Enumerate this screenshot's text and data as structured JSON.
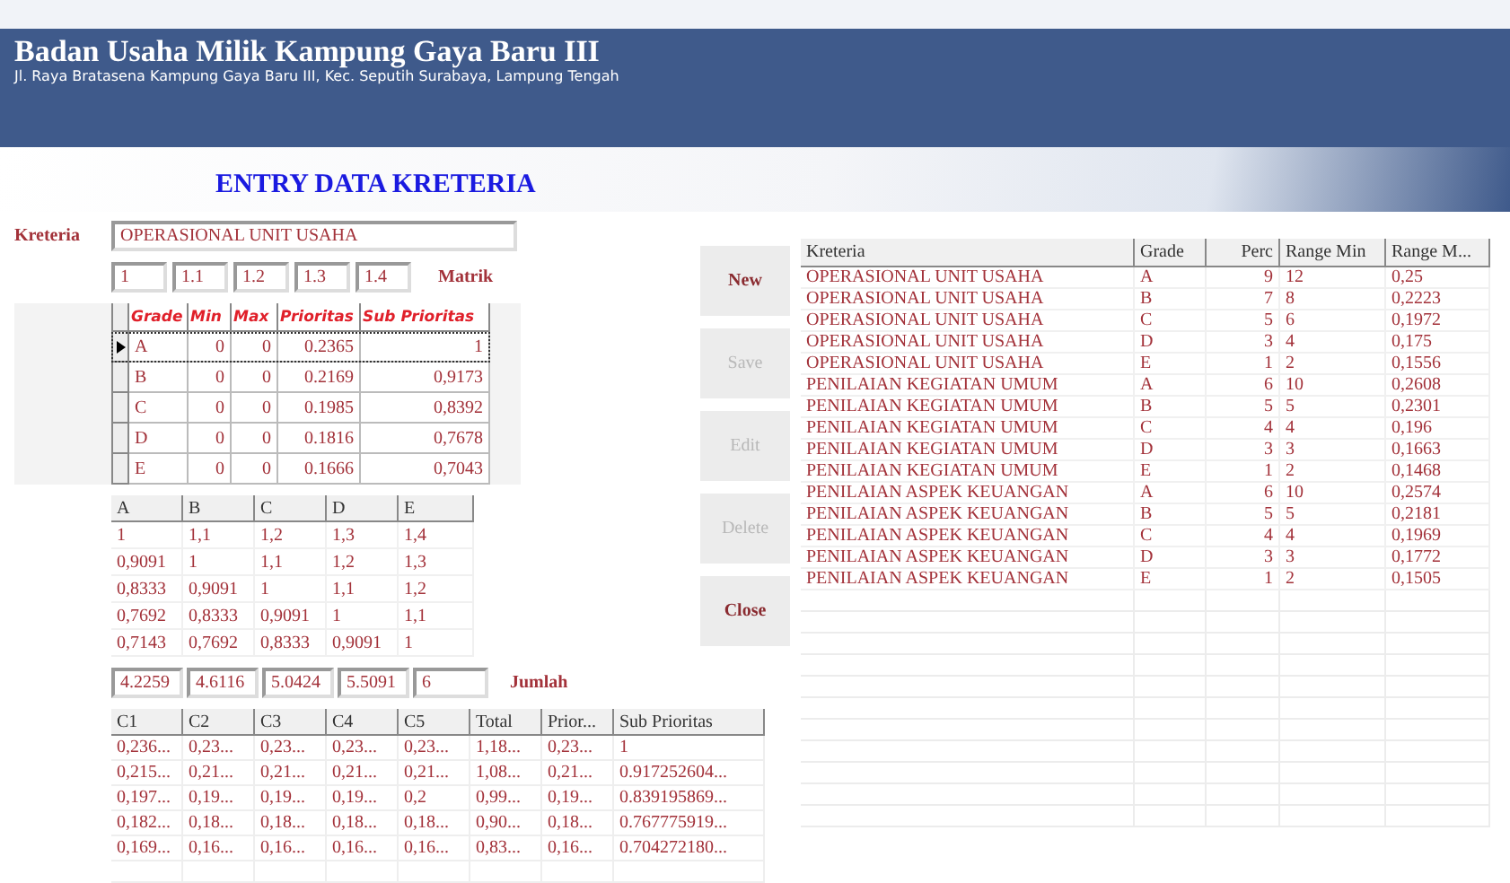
{
  "header": {
    "title": "Badan Usaha Milik Kampung Gaya Baru III",
    "address": "Jl. Raya Bratasena Kampung Gaya Baru III, Kec. Seputih Surabaya, Lampung Tengah"
  },
  "form_title": "ENTRY DATA KRETERIA",
  "kreteria": {
    "label": "Kreteria",
    "value": "OPERASIONAL UNIT USAHA"
  },
  "matrix_inputs": {
    "values": [
      "1",
      "1.1",
      "1.2",
      "1.3",
      "1.4"
    ],
    "label": "Matrik"
  },
  "grade_grid": {
    "columns": [
      "Grade",
      "Min",
      "Max",
      "Prioritas",
      "Sub Prioritas"
    ],
    "rows": [
      {
        "cells": [
          "A",
          "0",
          "0",
          "0.2365",
          "1"
        ],
        "selected": true
      },
      {
        "cells": [
          "B",
          "0",
          "0",
          "0.2169",
          "0,9173"
        ],
        "selected": false
      },
      {
        "cells": [
          "C",
          "0",
          "0",
          "0.1985",
          "0,8392"
        ],
        "selected": false
      },
      {
        "cells": [
          "D",
          "0",
          "0",
          "0.1816",
          "0,7678"
        ],
        "selected": false
      },
      {
        "cells": [
          "E",
          "0",
          "0",
          "0.1666",
          "0,7043"
        ],
        "selected": false
      }
    ]
  },
  "pairwise_matrix": {
    "columns": [
      "A",
      "B",
      "C",
      "D",
      "E"
    ],
    "rows": [
      [
        "1",
        "1,1",
        "1,2",
        "1,3",
        "1,4"
      ],
      [
        "0,9091",
        "1",
        "1,1",
        "1,2",
        "1,3"
      ],
      [
        "0,8333",
        "0,9091",
        "1",
        "1,1",
        "1,2"
      ],
      [
        "0,7692",
        "0,8333",
        "0,9091",
        "1",
        "1,1"
      ],
      [
        "0,7143",
        "0,7692",
        "0,8333",
        "0,9091",
        "1"
      ]
    ]
  },
  "jumlah": {
    "values": [
      "4.2259",
      "4.6116",
      "5.0424",
      "5.5091",
      "6"
    ],
    "label": "Jumlah"
  },
  "normalized": {
    "columns": [
      "C1",
      "C2",
      "C3",
      "C4",
      "C5",
      "Total",
      "Prior...",
      "Sub Prioritas"
    ],
    "rows": [
      [
        "0,236...",
        "0,23...",
        "0,23...",
        "0,23...",
        "0,23...",
        "1,18...",
        "0,23...",
        "1"
      ],
      [
        "0,215...",
        "0,21...",
        "0,21...",
        "0,21...",
        "0,21...",
        "1,08...",
        "0,21...",
        "0.917252604..."
      ],
      [
        "0,197...",
        "0,19...",
        "0,19...",
        "0,19...",
        "0,2",
        "0,99...",
        "0,19...",
        "0.839195869..."
      ],
      [
        "0,182...",
        "0,18...",
        "0,18...",
        "0,18...",
        "0,18...",
        "0,90...",
        "0,18...",
        "0.767775919..."
      ],
      [
        "0,169...",
        "0,16...",
        "0,16...",
        "0,16...",
        "0,16...",
        "0,83...",
        "0,16...",
        "0.704272180..."
      ]
    ]
  },
  "buttons": [
    {
      "label": "New",
      "disabled": false
    },
    {
      "label": "Save",
      "disabled": true
    },
    {
      "label": "Edit",
      "disabled": true
    },
    {
      "label": "Delete",
      "disabled": true
    },
    {
      "label": "Close",
      "disabled": false
    }
  ],
  "list_table": {
    "columns": [
      "Kreteria",
      "Grade",
      "Perc",
      "Range Min",
      "Range M..."
    ],
    "rows": [
      [
        "OPERASIONAL UNIT USAHA",
        "A",
        "9",
        "12",
        "0,25"
      ],
      [
        "OPERASIONAL UNIT USAHA",
        "B",
        "7",
        "8",
        "0,2223"
      ],
      [
        "OPERASIONAL UNIT USAHA",
        "C",
        "5",
        "6",
        "0,1972"
      ],
      [
        "OPERASIONAL UNIT USAHA",
        "D",
        "3",
        "4",
        "0,175"
      ],
      [
        "OPERASIONAL UNIT USAHA",
        "E",
        "1",
        "2",
        "0,1556"
      ],
      [
        "PENILAIAN KEGIATAN UMUM",
        "A",
        "6",
        "10",
        "0,2608"
      ],
      [
        "PENILAIAN KEGIATAN UMUM",
        "B",
        "5",
        "5",
        "0,2301"
      ],
      [
        "PENILAIAN KEGIATAN UMUM",
        "C",
        "4",
        "4",
        "0,196"
      ],
      [
        "PENILAIAN KEGIATAN UMUM",
        "D",
        "3",
        "3",
        "0,1663"
      ],
      [
        "PENILAIAN KEGIATAN UMUM",
        "E",
        "1",
        "2",
        "0,1468"
      ],
      [
        "PENILAIAN ASPEK KEUANGAN",
        "A",
        "6",
        "10",
        "0,2574"
      ],
      [
        "PENILAIAN ASPEK KEUANGAN",
        "B",
        "5",
        "5",
        "0,2181"
      ],
      [
        "PENILAIAN ASPEK KEUANGAN",
        "C",
        "4",
        "4",
        "0,1969"
      ],
      [
        "PENILAIAN ASPEK KEUANGAN",
        "D",
        "3",
        "3",
        "0,1772"
      ],
      [
        "PENILAIAN ASPEK KEUANGAN",
        "E",
        "1",
        "2",
        "0,1505"
      ]
    ]
  }
}
